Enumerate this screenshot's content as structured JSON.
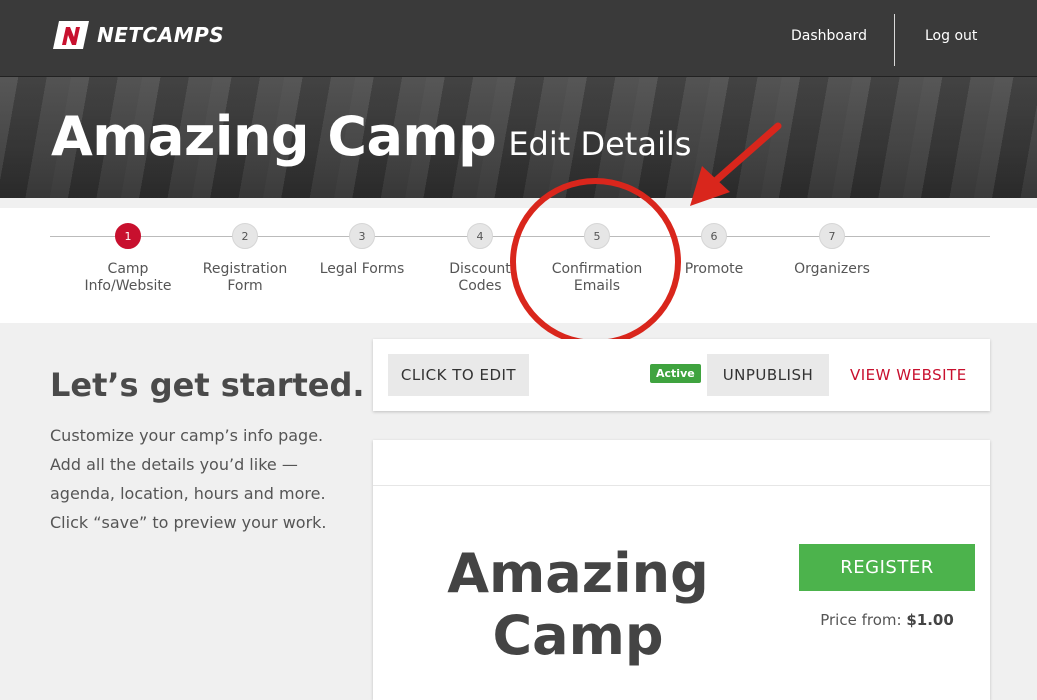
{
  "header": {
    "logo_text": "NETCAMPS",
    "nav": {
      "dashboard": "Dashboard",
      "logout": "Log out"
    }
  },
  "hero": {
    "title": "Amazing Camp",
    "subtitle": "Edit Details"
  },
  "steps": [
    {
      "num": "1",
      "label": "Camp Info/Website",
      "active": true
    },
    {
      "num": "2",
      "label": "Registration Form"
    },
    {
      "num": "3",
      "label": "Legal Forms"
    },
    {
      "num": "4",
      "label": "Discount Codes"
    },
    {
      "num": "5",
      "label": "Confirmation Emails"
    },
    {
      "num": "6",
      "label": "Promote"
    },
    {
      "num": "7",
      "label": "Organizers"
    }
  ],
  "intro": {
    "heading": "Let’s get started.",
    "body": "Customize your camp’s info page. Add all the details you’d like — agenda, location, hours and more. Click “save” to preview your work."
  },
  "toolbar": {
    "edit_label": "CLICK TO EDIT",
    "status_badge": "Active",
    "unpublish_label": "UNPUBLISH",
    "view_label": "VIEW WEBSITE"
  },
  "preview": {
    "camp_title": "Amazing Camp",
    "register_label": "REGISTER",
    "price_label": "Price from:",
    "price_value": "$1.00"
  },
  "colors": {
    "accent_red": "#c8102e",
    "register_green": "#4cb34c",
    "active_green": "#3fa33f",
    "annotation_red": "#d9261c"
  }
}
